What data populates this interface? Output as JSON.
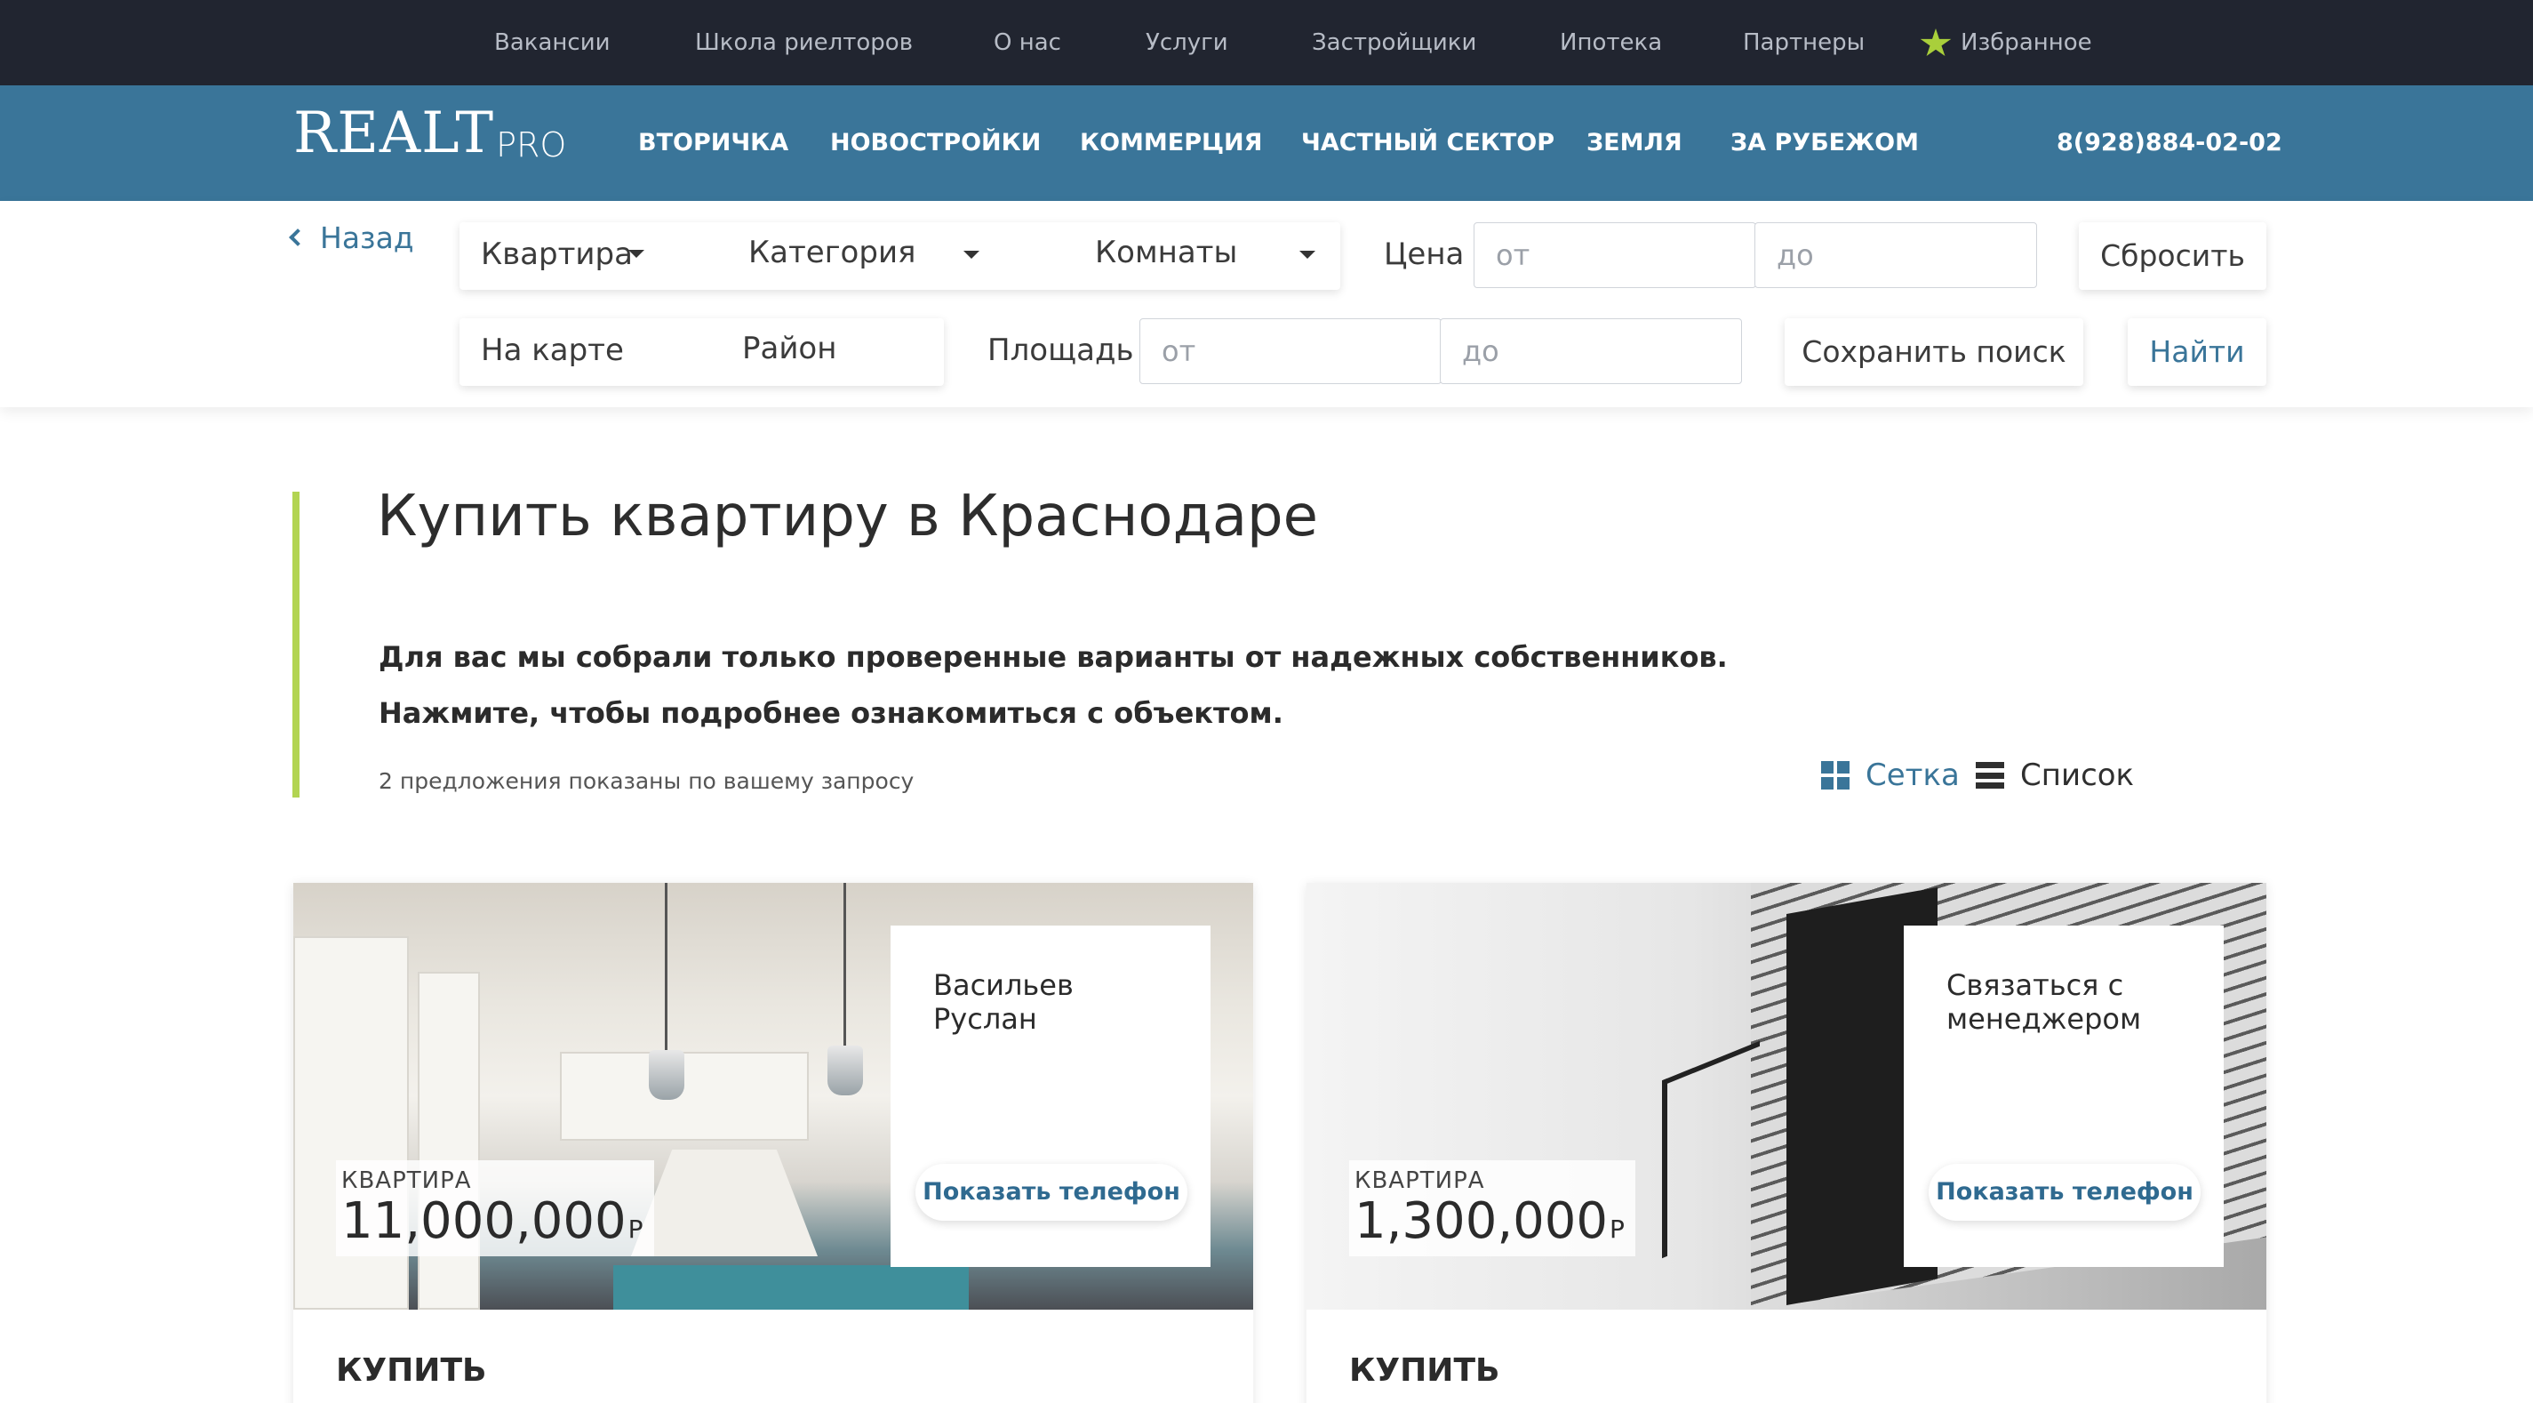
{
  "topbar": {
    "links": [
      "Вакансии",
      "Школа риелторов",
      "О нас",
      "Услуги",
      "Застройщики",
      "Ипотека",
      "Партнеры"
    ],
    "favorites": "Избранное"
  },
  "brand": {
    "logo_main": "REALT",
    "logo_suffix": "PRO"
  },
  "nav": {
    "items": [
      "ВТОРИЧКА",
      "НОВОСТРОЙКИ",
      "КОММЕРЦИЯ",
      "ЧАСТНЫЙ СЕКТОР",
      "ЗЕМЛЯ",
      "ЗА РУБЕЖОМ"
    ],
    "phone": "8(928)884-02-02"
  },
  "filters": {
    "back_label": "Назад",
    "type": "Квартира",
    "category": "Категория",
    "rooms": "Комнаты",
    "price_label": "Цена",
    "price_from_placeholder": "от",
    "price_to_placeholder": "до",
    "reset_label": "Сбросить",
    "map_label": "На карте",
    "district_label": "Район",
    "area_label": "Площадь",
    "area_from_placeholder": "от",
    "area_to_placeholder": "до",
    "save_search_label": "Сохранить поиск",
    "find_label": "Найти"
  },
  "intro": {
    "title": "Купить квартиру в Краснодаре",
    "line1": "Для вас мы собрали только проверенные варианты от надежных собственников.",
    "line2": "Нажмите, чтобы подробнее ознакомиться с объектом.",
    "count_text": "2 предложения показаны по вашему запросу",
    "view_grid": "Сетка",
    "view_list": "Список"
  },
  "listings": [
    {
      "kind": "КВАРТИРА",
      "price": "11,000,000",
      "currency": "Р",
      "agent": "Васильев Руслан",
      "phone_button": "Показать телефон",
      "action": "КУПИТЬ"
    },
    {
      "kind": "КВАРТИРА",
      "price": "1,300,000",
      "currency": "Р",
      "agent": "Связаться с менеджером",
      "phone_button": "Показать телефон",
      "action": "КУПИТЬ"
    }
  ],
  "colors": {
    "topbar": "#212530",
    "nav": "#3a7599",
    "accent": "#b2d452",
    "link": "#3a7599",
    "star": "#a9cf3b"
  },
  "icons": {
    "back": "chevron-left-icon",
    "favorites": "star-icon",
    "grid_view": "grid-icon",
    "list_view": "list-icon",
    "dropdown": "caret-down-icon"
  }
}
